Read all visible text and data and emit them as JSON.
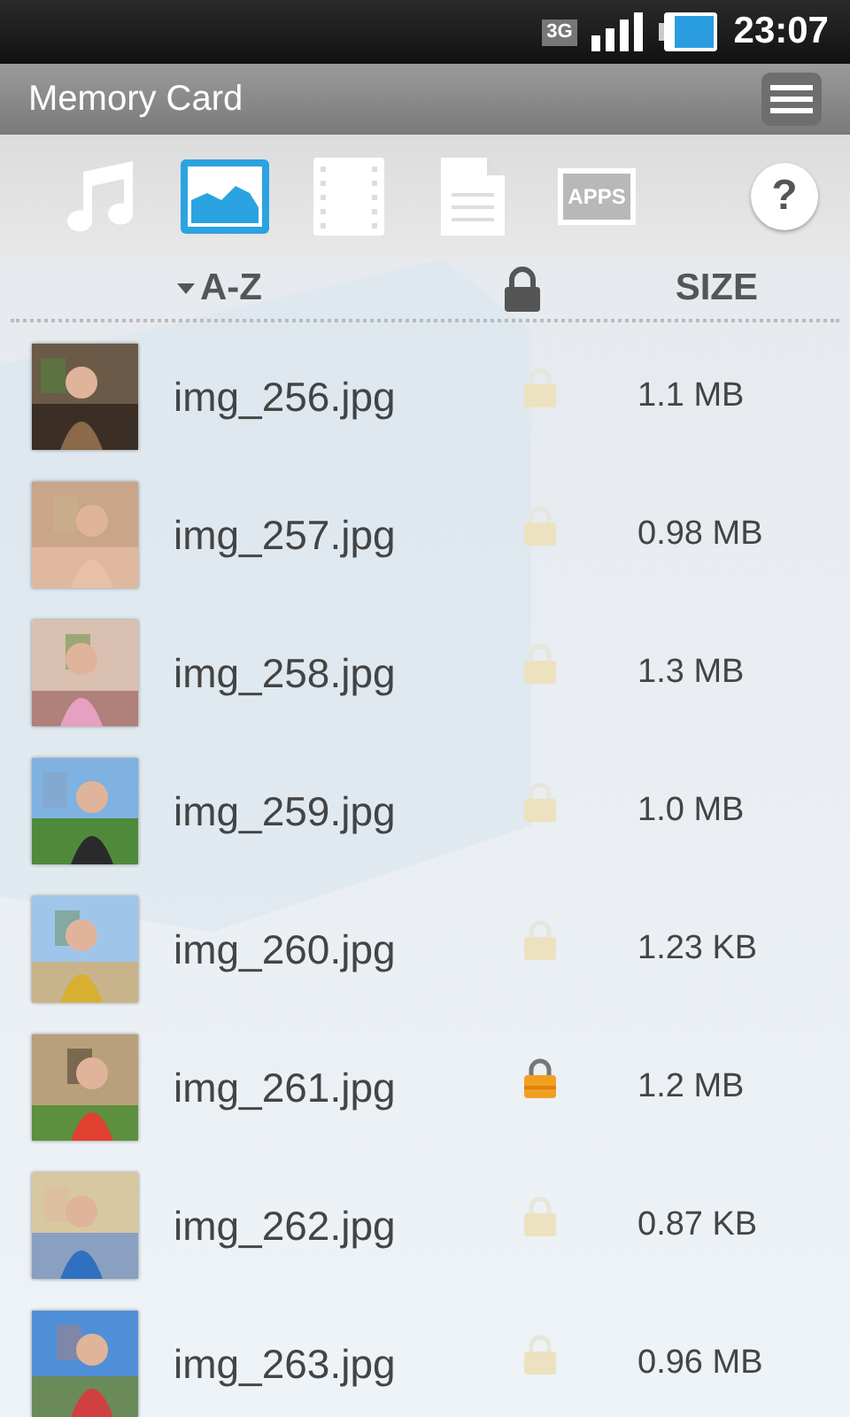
{
  "status_bar": {
    "network": "3G",
    "time": "23:07"
  },
  "title_bar": {
    "title": "Memory Card"
  },
  "tabs": [
    {
      "kind": "music",
      "selected": false
    },
    {
      "kind": "images",
      "selected": true
    },
    {
      "kind": "video",
      "selected": false
    },
    {
      "kind": "documents",
      "selected": false
    },
    {
      "kind": "apps",
      "label": "APPS",
      "selected": false
    },
    {
      "kind": "help",
      "label": "?",
      "selected": false
    }
  ],
  "columns": {
    "name": "A-Z",
    "size": "SIZE"
  },
  "files": [
    {
      "name": "img_256.jpg",
      "locked": false,
      "size": "1.1 MB"
    },
    {
      "name": "img_257.jpg",
      "locked": false,
      "size": "0.98 MB"
    },
    {
      "name": "img_258.jpg",
      "locked": false,
      "size": "1.3 MB"
    },
    {
      "name": "img_259.jpg",
      "locked": false,
      "size": "1.0 MB"
    },
    {
      "name": "img_260.jpg",
      "locked": false,
      "size": "1.23 KB"
    },
    {
      "name": "img_261.jpg",
      "locked": true,
      "size": "1.2 MB"
    },
    {
      "name": "img_262.jpg",
      "locked": false,
      "size": "0.87 KB"
    },
    {
      "name": "img_263.jpg",
      "locked": false,
      "size": "0.96 MB"
    }
  ]
}
